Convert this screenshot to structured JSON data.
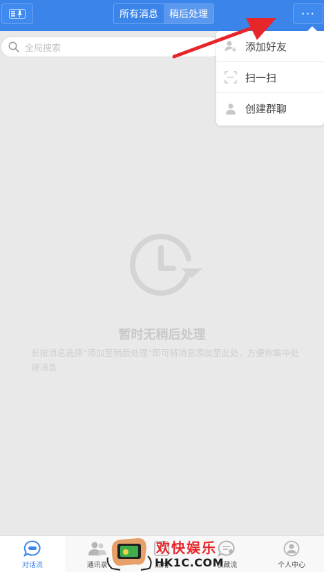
{
  "header": {
    "tabs": [
      {
        "label": "所有消息",
        "active": false
      },
      {
        "label": "稍后处理",
        "active": true
      }
    ],
    "more_label": "···"
  },
  "search": {
    "placeholder": "全局搜索"
  },
  "empty_state": {
    "title": "暂时无稍后处理",
    "description": "长按消息选择“添加至稍后处理”即可将消息添加至此处，方便你集中处理消息"
  },
  "dropdown": {
    "items": [
      {
        "label": "添加好友",
        "icon": "add-friend-icon"
      },
      {
        "label": "扫一扫",
        "icon": "scan-icon"
      },
      {
        "label": "创建群聊",
        "icon": "create-group-icon"
      }
    ]
  },
  "bottom_nav": {
    "items": [
      {
        "label": "对话流",
        "icon": "chat-icon",
        "active": true
      },
      {
        "label": "通讯录",
        "icon": "contacts-icon",
        "active": false
      },
      {
        "label": "应用",
        "icon": "apps-icon",
        "active": false
      },
      {
        "label": "收藏流",
        "icon": "favorites-icon",
        "active": false
      },
      {
        "label": "个人中心",
        "icon": "profile-icon",
        "active": false
      }
    ]
  },
  "watermark": {
    "cn": "欢快娱乐",
    "en": "HK1C.COM"
  },
  "colors": {
    "primary": "#3a84ea",
    "background": "#e9e9e9",
    "arrow": "#e7262c"
  }
}
